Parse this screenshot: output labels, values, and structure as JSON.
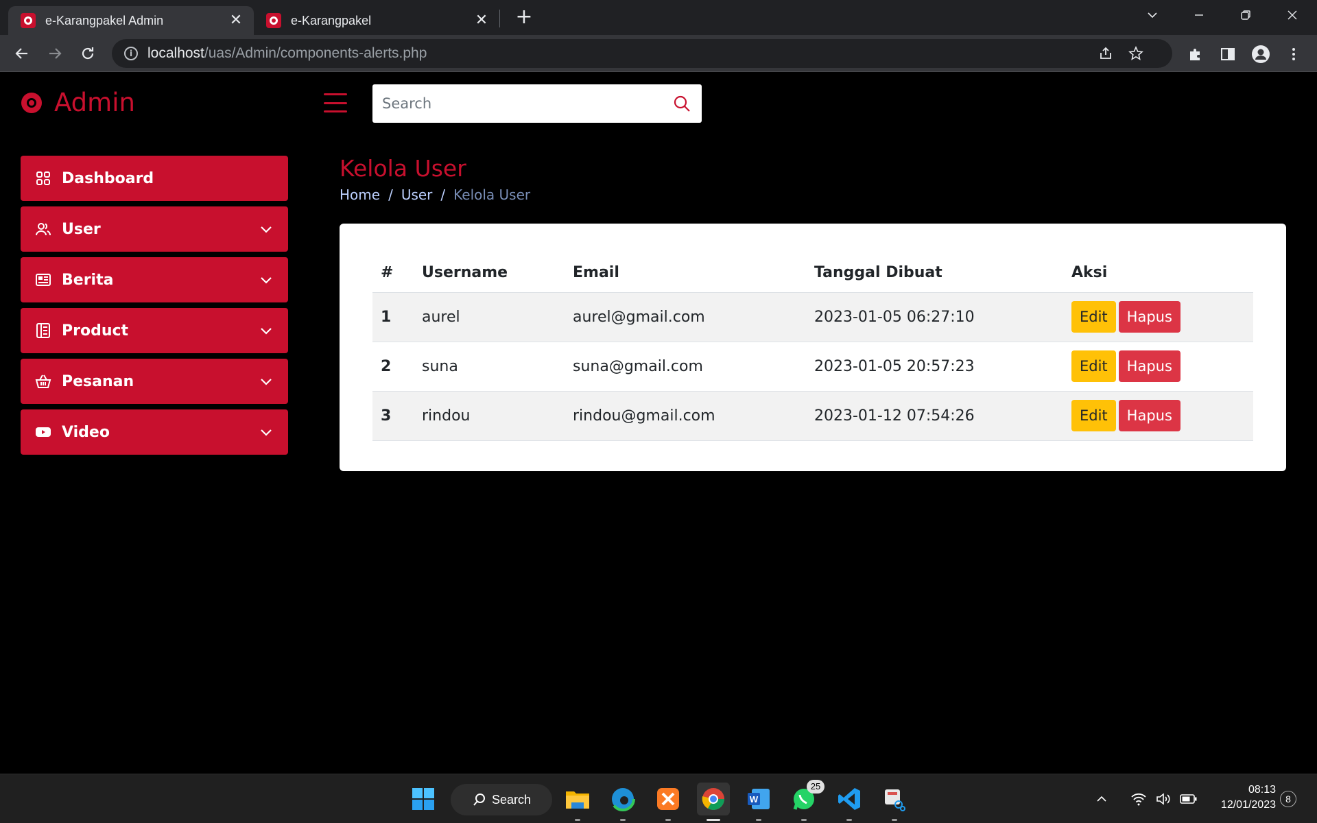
{
  "browser": {
    "tabs": [
      {
        "title": "e-Karangpakel Admin"
      },
      {
        "title": "e-Karangpakel"
      }
    ],
    "url_host": "localhost",
    "url_path": "/uas/Admin/components-alerts.php"
  },
  "header": {
    "brand": "Admin",
    "search_placeholder": "Search"
  },
  "sidebar": {
    "items": [
      {
        "label": "Dashboard",
        "icon": "grid-icon"
      },
      {
        "label": "User",
        "icon": "users-icon"
      },
      {
        "label": "Berita",
        "icon": "newspaper-icon"
      },
      {
        "label": "Product",
        "icon": "list-icon"
      },
      {
        "label": "Pesanan",
        "icon": "basket-icon"
      },
      {
        "label": "Video",
        "icon": "youtube-icon"
      }
    ]
  },
  "main": {
    "title": "Kelola User",
    "breadcrumb": [
      "Home",
      "User",
      "Kelola User"
    ],
    "table": {
      "headers": [
        "#",
        "Username",
        "Email",
        "Tanggal Dibuat",
        "Aksi"
      ],
      "rows": [
        {
          "num": "1",
          "username": "aurel",
          "email": "aurel@gmail.com",
          "created": "2023-01-05 06:27:10"
        },
        {
          "num": "2",
          "username": "suna",
          "email": "suna@gmail.com",
          "created": "2023-01-05 20:57:23"
        },
        {
          "num": "3",
          "username": "rindou",
          "email": "rindou@gmail.com",
          "created": "2023-01-12 07:54:26"
        }
      ],
      "edit_label": "Edit",
      "delete_label": "Hapus"
    }
  },
  "taskbar": {
    "search_label": "Search",
    "whatsapp_badge": "25",
    "time": "08:13",
    "date": "12/01/2023",
    "notification_count": "8"
  },
  "colors": {
    "brand": "#c8102e",
    "edit": "#ffc107",
    "delete": "#dc3545"
  }
}
